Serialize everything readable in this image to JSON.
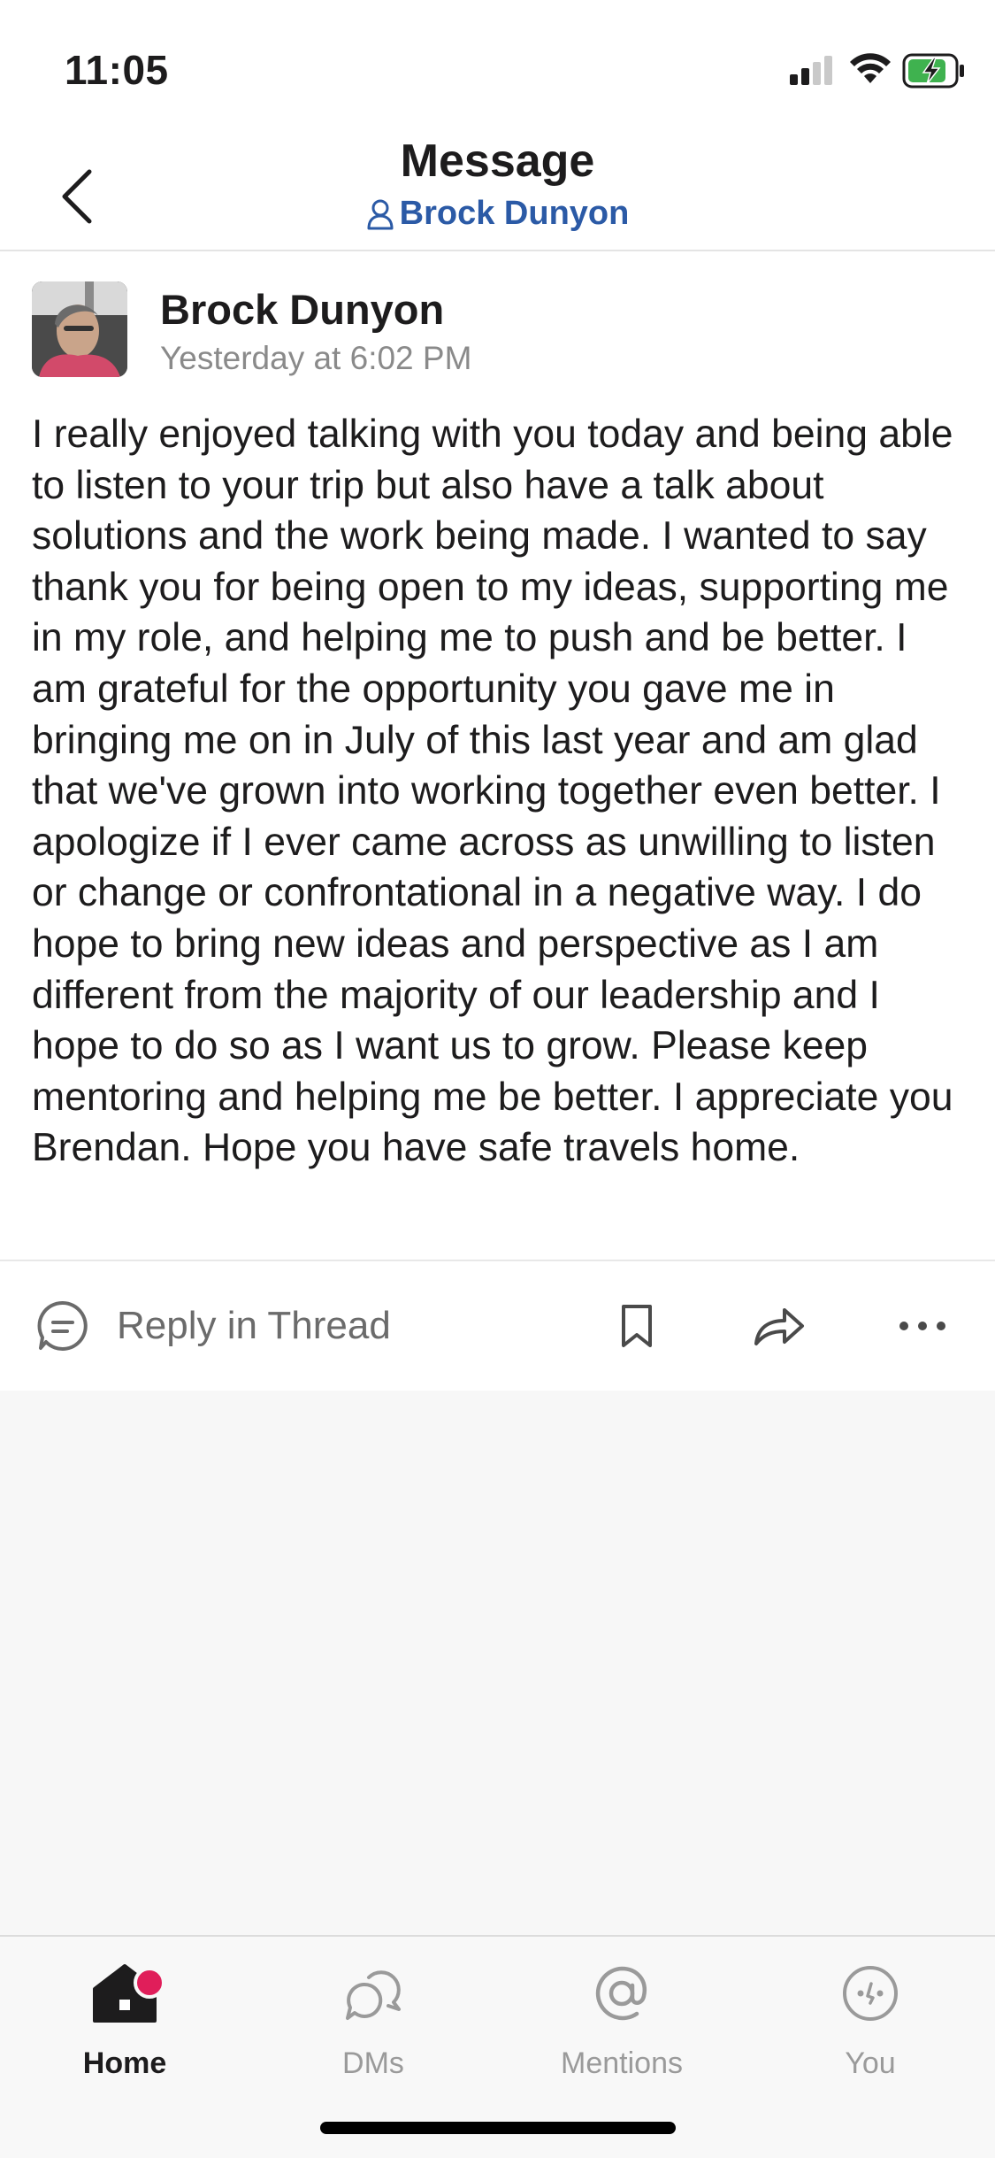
{
  "status_bar": {
    "time": "11:05"
  },
  "header": {
    "title": "Message",
    "subtitle": "Brock Dunyon"
  },
  "message": {
    "author": "Brock Dunyon",
    "timestamp": "Yesterday at 6:02 PM",
    "body": "I really enjoyed talking with you today and being able to listen to your trip but also have a talk about solutions and the work being made. I wanted to say thank you for being open to my ideas, supporting me in my role, and helping me to push and be better. I am grateful for the opportunity you gave me in bringing me on in July of this last year and am glad that we've grown into working together even better. I apologize if I ever came across as unwilling to listen or change or confrontational in a negative way. I do hope to bring new ideas and perspective as I am different from the majority of our leadership and I hope to do so as I want us to grow. Please keep mentoring and helping me be better. I appreciate you Brendan. Hope you have safe travels home."
  },
  "actions": {
    "reply_label": "Reply in Thread"
  },
  "tabs": [
    {
      "label": "Home",
      "icon": "home-icon",
      "active": true
    },
    {
      "label": "DMs",
      "icon": "dms-icon",
      "active": false
    },
    {
      "label": "Mentions",
      "icon": "mentions-icon",
      "active": false
    },
    {
      "label": "You",
      "icon": "you-icon",
      "active": false
    }
  ],
  "colors": {
    "accent_link": "#2b5aa6",
    "badge": "#e01e5a",
    "battery_charging": "#3fb24f"
  }
}
